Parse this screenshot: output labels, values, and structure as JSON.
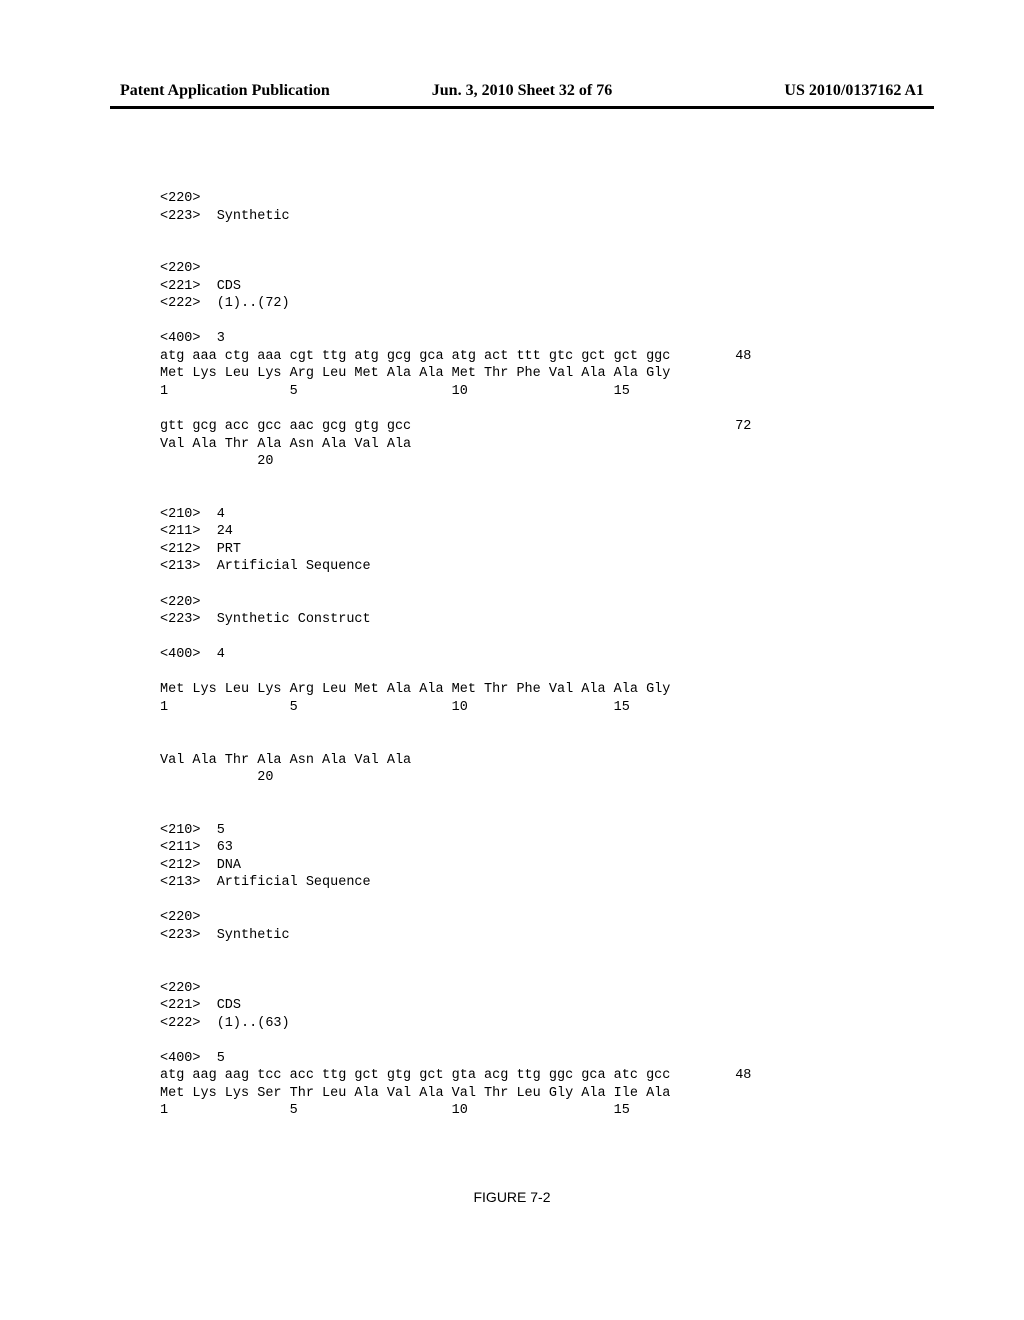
{
  "header": {
    "left": "Patent Application Publication",
    "center": "Jun. 3, 2010  Sheet 32 of 76",
    "right": "US 2010/0137162 A1"
  },
  "figure_label": "FIGURE 7-2",
  "sequence_listing": "<220>\n<223>  Synthetic\n\n\n<220>\n<221>  CDS\n<222>  (1)..(72)\n\n<400>  3\natg aaa ctg aaa cgt ttg atg gcg gca atg act ttt gtc gct gct ggc        48\nMet Lys Leu Lys Arg Leu Met Ala Ala Met Thr Phe Val Ala Ala Gly\n1               5                   10                  15\n\ngtt gcg acc gcc aac gcg gtg gcc                                        72\nVal Ala Thr Ala Asn Ala Val Ala\n            20\n\n\n<210>  4\n<211>  24\n<212>  PRT\n<213>  Artificial Sequence\n\n<220>\n<223>  Synthetic Construct\n\n<400>  4\n\nMet Lys Leu Lys Arg Leu Met Ala Ala Met Thr Phe Val Ala Ala Gly\n1               5                   10                  15\n\n\nVal Ala Thr Ala Asn Ala Val Ala\n            20\n\n\n<210>  5\n<211>  63\n<212>  DNA\n<213>  Artificial Sequence\n\n<220>\n<223>  Synthetic\n\n\n<220>\n<221>  CDS\n<222>  (1)..(63)\n\n<400>  5\natg aag aag tcc acc ttg gct gtg gct gta acg ttg ggc gca atc gcc        48\nMet Lys Lys Ser Thr Leu Ala Val Ala Val Thr Leu Gly Ala Ile Ala\n1               5                   10                  15"
}
